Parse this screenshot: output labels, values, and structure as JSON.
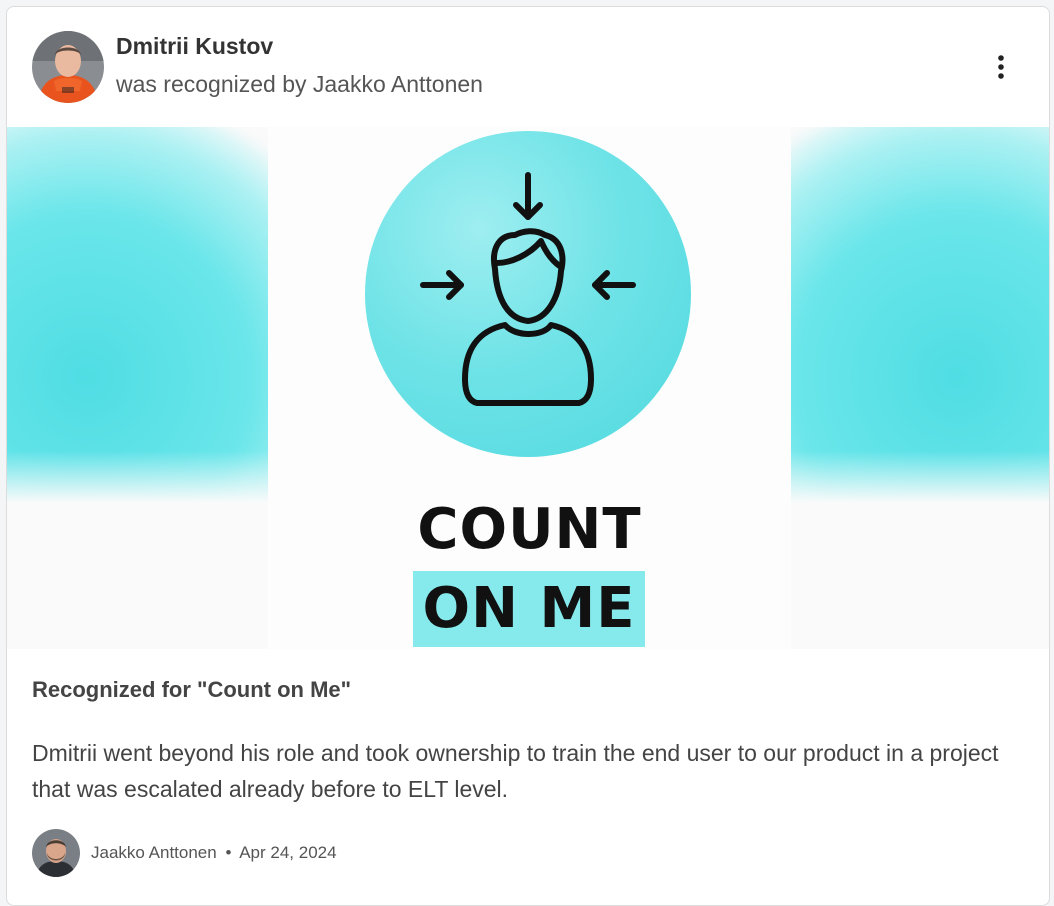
{
  "post": {
    "recipient_name": "Dmitrii Kustov",
    "recognized_by_text": "was recognized by Jaakko Anttonen",
    "more_menu_icon": "vertical-ellipsis-icon"
  },
  "badge": {
    "line1": "COUNT",
    "line2": "ON ME",
    "icon": "person-focus-arrows-icon",
    "accent_color": "#5ddde2",
    "highlight_color": "#86eaed"
  },
  "body": {
    "recognized_for": "Recognized for \"Count on Me\"",
    "message": "Dmitrii went beyond his role and took ownership to train the end user to our product in a project that was escalated already before to ELT level."
  },
  "footer": {
    "author": "Jaakko Anttonen",
    "separator": "•",
    "date": "Apr 24, 2024"
  }
}
